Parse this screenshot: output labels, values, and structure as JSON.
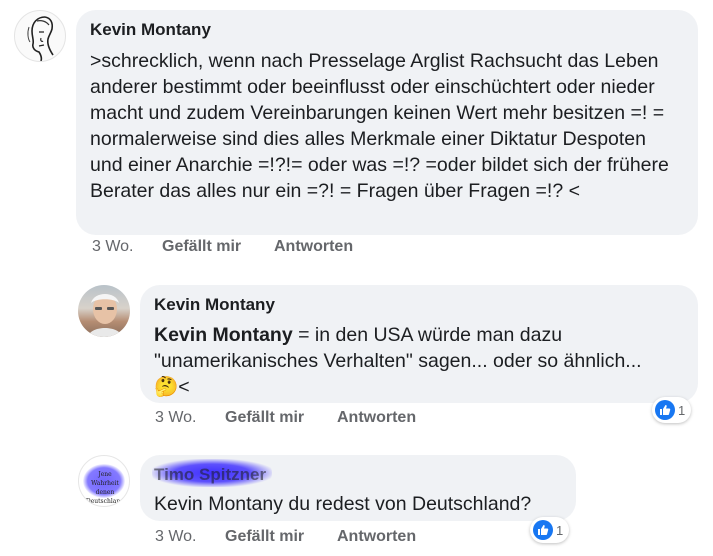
{
  "comments": [
    {
      "author": "Kevin Montany",
      "text": ">schrecklich, wenn nach Presselage Arglist Rachsucht das Leben anderer bestimmt oder beeinflusst oder einschüchtert oder nieder macht und zudem Vereinbarungen keinen Wert mehr besitzen =! = normalerweise sind dies alles Merkmale einer Diktatur Despoten und einer Anarchie  =!?!= oder was =!? =oder bildet sich der frühere Berater das alles nur ein =?! = Fragen über Fragen =!? <",
      "time": "3 Wo.",
      "like_label": "Gefällt mir",
      "reply_label": "Antworten",
      "avatar_icon": "sketch-face-avatar"
    },
    {
      "author": "Kevin Montany",
      "mention": "Kevin Montany",
      "text": " = in den USA würde man dazu \"unamerikanisches Verhalten\" sagen... oder so ähnlich...",
      "emoji": "🤔",
      "text_end": "<",
      "time": "3 Wo.",
      "like_label": "Gefällt mir",
      "reply_label": "Antworten",
      "reaction_count": "1",
      "reaction_icon": "thumbs-up-icon",
      "avatar_icon": "photo-avatar"
    },
    {
      "author": "Timo Spitzner",
      "text": "Kevin Montany du redest von Deutschland?",
      "time": "3 Wo.",
      "like_label": "Gefällt mir",
      "reply_label": "Antworten",
      "reaction_count": "1",
      "reaction_icon": "thumbs-up-icon",
      "avatar_icon": "blurred-avatar",
      "avatar_text": "Jene Wahrheit denen Deutschland"
    }
  ],
  "colors": {
    "bubble": "#f0f2f5",
    "like_blue": "#1877f2",
    "meta_gray": "#65676b",
    "redaction_blue": "#2d1bff"
  }
}
